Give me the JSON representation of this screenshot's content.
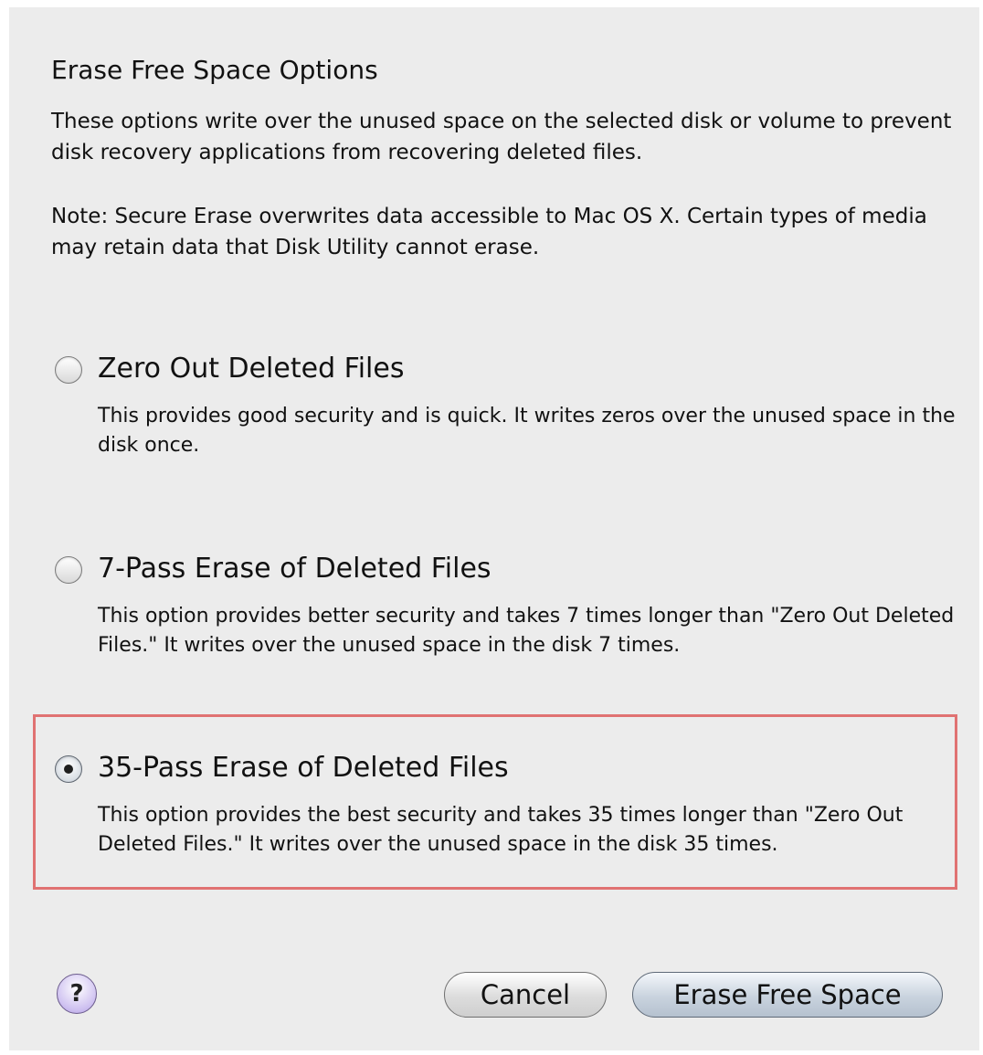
{
  "dialog": {
    "title": "Erase Free Space Options",
    "description": "These options write over the unused space on the selected disk or volume to prevent disk recovery applications from recovering deleted files.",
    "note": "Note: Secure Erase overwrites data accessible to Mac OS X.  Certain types of media may retain data that Disk Utility cannot erase."
  },
  "options": [
    {
      "label": "Zero Out Deleted Files",
      "description": "This provides good security and is quick. It writes zeros over the unused space in the disk once.",
      "selected": false
    },
    {
      "label": "7-Pass Erase of Deleted Files",
      "description": "This option provides better security and takes 7 times longer than \"Zero Out Deleted Files.\" It writes over the unused space in the disk 7 times.",
      "selected": false
    },
    {
      "label": "35-Pass Erase of Deleted Files",
      "description": "This option provides the best security and takes 35 times longer than \"Zero Out Deleted Files.\" It writes over the unused space in the disk 35 times.",
      "selected": true
    }
  ],
  "buttons": {
    "help_label": "?",
    "cancel_label": "Cancel",
    "erase_label": "Erase Free Space"
  },
  "icons": {
    "help": "question-icon",
    "radio_selected": "radio-selected-icon",
    "radio_unselected": "radio-unselected-icon"
  },
  "colors": {
    "highlight_border": "#e07272",
    "dialog_background": "#ececec"
  }
}
